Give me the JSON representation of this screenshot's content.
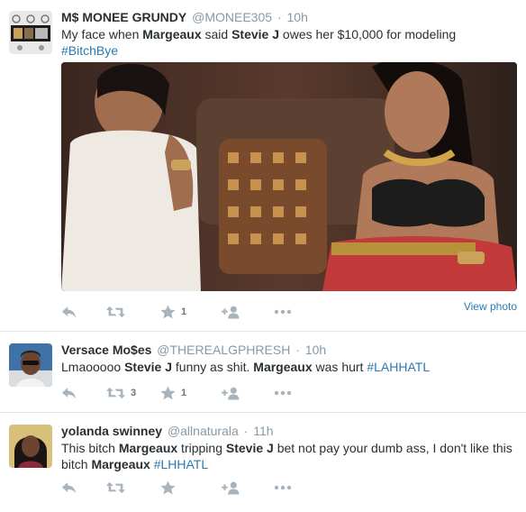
{
  "tweets": [
    {
      "fullname": "M$ MONEE GRUNDY",
      "username": "@MONEE305",
      "dot": "·",
      "time": "10h",
      "text": {
        "p1": "My face when ",
        "b1": "Margeaux",
        "p2": " said ",
        "b2": "Stevie J",
        "p3": " owes her $10,000 for modeling",
        "hashtag": "#BitchBye"
      },
      "retweet_count": "",
      "favorite_count": "1",
      "view_photo": "View photo"
    },
    {
      "fullname": "Versace Mo$es",
      "username": "@THEREALGPHRESH",
      "dot": "·",
      "time": "10h",
      "text": {
        "p1": "Lmaooooo ",
        "b1": "Stevie J",
        "p2": " funny as shit. ",
        "b2": "Margeaux",
        "p3": " was hurt ",
        "hashtag": "#LAHHATL"
      },
      "retweet_count": "3",
      "favorite_count": "1"
    },
    {
      "fullname": "yolanda swinney",
      "username": "@allnaturala",
      "dot": "·",
      "time": "11h",
      "text": {
        "p1": "This bitch ",
        "b1": "Margeaux",
        "p2": " tripping ",
        "b2": "Stevie J",
        "p3": " bet not pay your dumb ass, I don't like this bitch ",
        "b3": "Margeaux",
        "p4": " ",
        "hashtag": "#LHHATL"
      },
      "retweet_count": "",
      "favorite_count": ""
    }
  ],
  "colors": {
    "text": "#292f33",
    "muted": "#8899a6",
    "link": "#2a7ab0",
    "icon": "#a7b4bd",
    "divider": "#e1e8ed"
  },
  "icons": {
    "reply": "reply-icon",
    "retweet": "retweet-icon",
    "favorite": "star-icon",
    "follow": "follow-icon",
    "more": "more-icon"
  }
}
